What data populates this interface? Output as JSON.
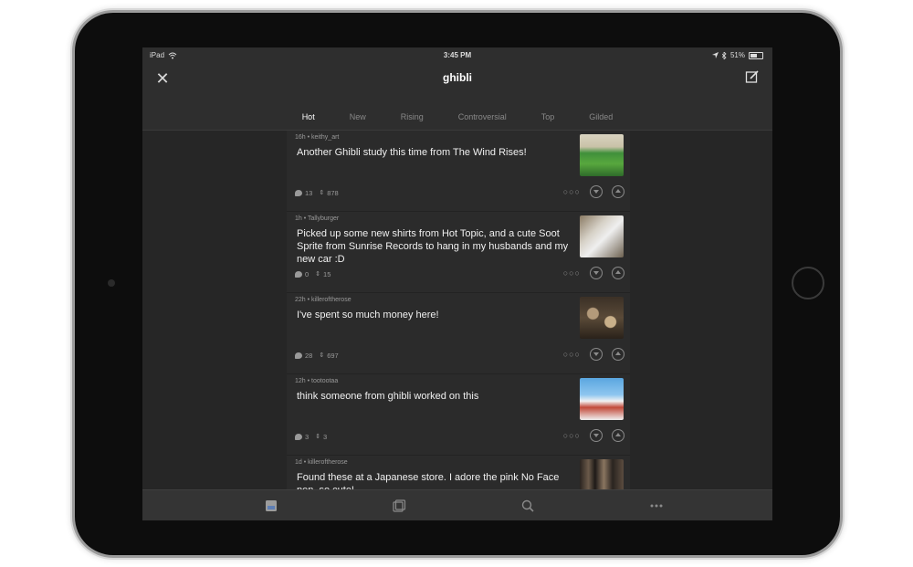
{
  "statusbar": {
    "device": "iPad",
    "time": "3:45 PM",
    "battery": "51%"
  },
  "nav": {
    "title": "ghibli",
    "close_icon": "close-icon",
    "compose_icon": "compose-icon"
  },
  "tabs": [
    {
      "label": "Hot",
      "active": true
    },
    {
      "label": "New"
    },
    {
      "label": "Rising"
    },
    {
      "label": "Controversial"
    },
    {
      "label": "Top"
    },
    {
      "label": "Gilded"
    }
  ],
  "posts": [
    {
      "meta": "16h • keithy_art",
      "title": "Another Ghibli study this time from The Wind Rises!",
      "comments": "13",
      "score": "878"
    },
    {
      "meta": "1h • Tallyburger",
      "title": "Picked up some new shirts from Hot Topic, and a cute Soot Sprite from Sunrise Records to hang in my husbands and my new car :D",
      "comments": "0",
      "score": "15"
    },
    {
      "meta": "22h • killeroftherose",
      "title": "I've spent so much money here!",
      "comments": "28",
      "score": "697"
    },
    {
      "meta": "12h • tootootaa",
      "title": "think someone from ghibli worked on this",
      "comments": "3",
      "score": "3"
    },
    {
      "meta": "1d • killeroftherose",
      "title": "Found these at a Japanese store. I adore the pink No Face pen, so cute!",
      "comments": "",
      "score": ""
    }
  ],
  "tabbar": [
    "feed-icon",
    "gallery-icon",
    "search-icon",
    "more-icon"
  ]
}
